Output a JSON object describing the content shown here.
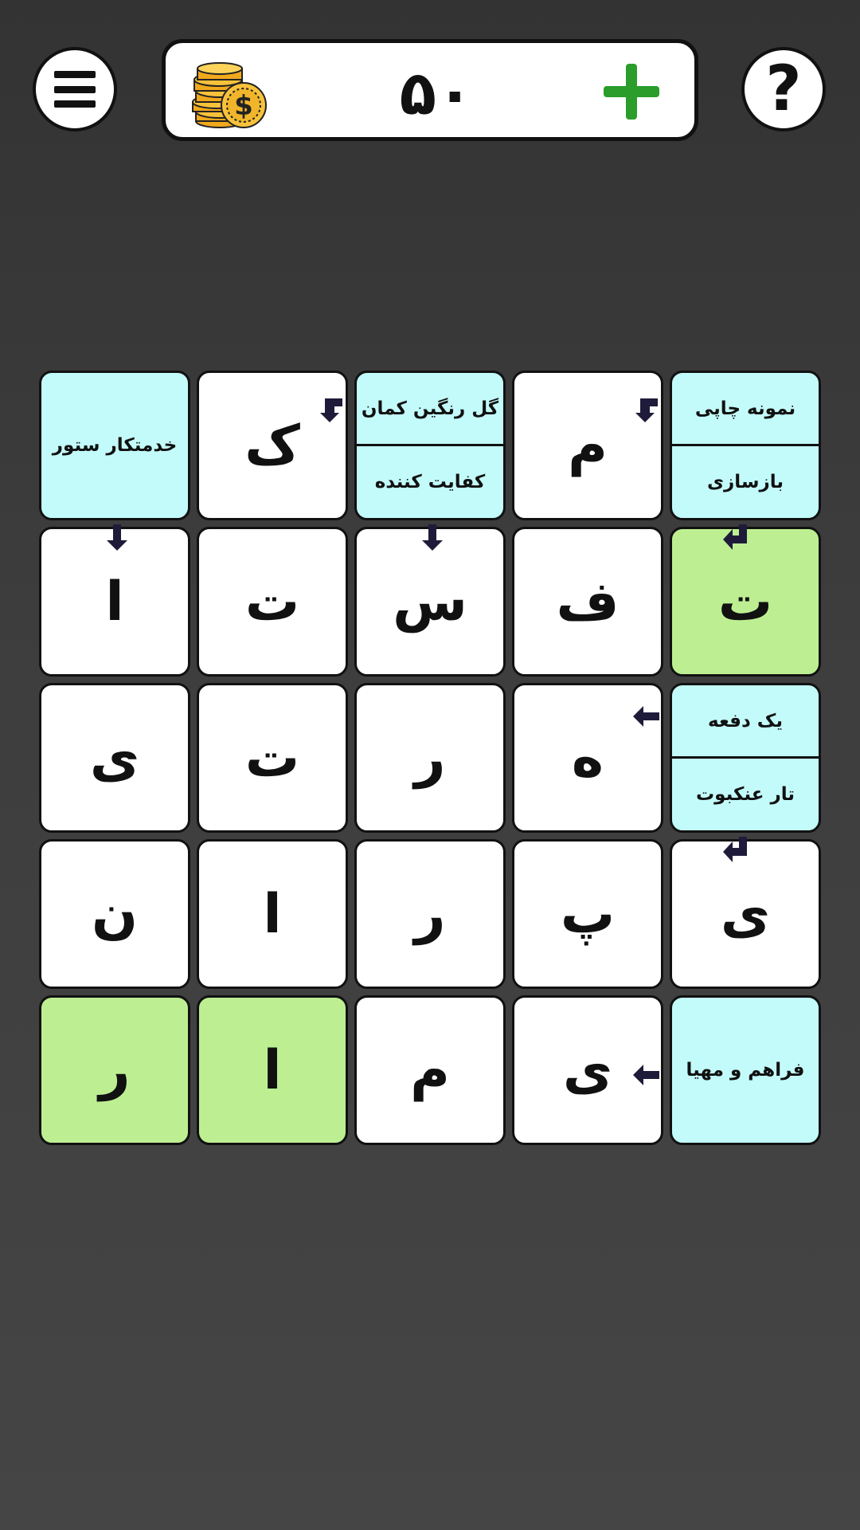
{
  "header": {
    "coins": "۵۰",
    "help_label": "?"
  },
  "colors": {
    "clue_bg": "#c3fbfa",
    "solved_bg": "#bdef92",
    "cell_bg": "#ffffff",
    "plus": "#2a9d2a",
    "arrow": "#1e1b3a"
  },
  "icons": [
    "menu-icon",
    "coin-stack-icon",
    "plus-icon",
    "help-icon",
    "arrow-icon"
  ],
  "grid": {
    "row1": {
      "c1": {
        "top": "نمونه چاپی",
        "bottom": "بازسازی"
      },
      "c2": "م",
      "c3": {
        "top": "گل رنگین کمان",
        "bottom": "کفایت کننده"
      },
      "c4": "ک",
      "c5": "خدمتکار ستور"
    },
    "row2": {
      "c1": "ت",
      "c2": "ف",
      "c3": "س",
      "c4": "ت",
      "c5": "ا"
    },
    "row3": {
      "c1": {
        "top": "یک دفعه",
        "bottom": "تار عنکبوت"
      },
      "c2": "ه",
      "c3": "ر",
      "c4": "ت",
      "c5": "ی"
    },
    "row4": {
      "c1": "ی",
      "c2": "پ",
      "c3": "ر",
      "c4": "ا",
      "c5": "ن"
    },
    "row5": {
      "c1": "فراهم و مهیا",
      "c2": "ی",
      "c3": "م",
      "c4": "ا",
      "c5": "ر"
    }
  }
}
